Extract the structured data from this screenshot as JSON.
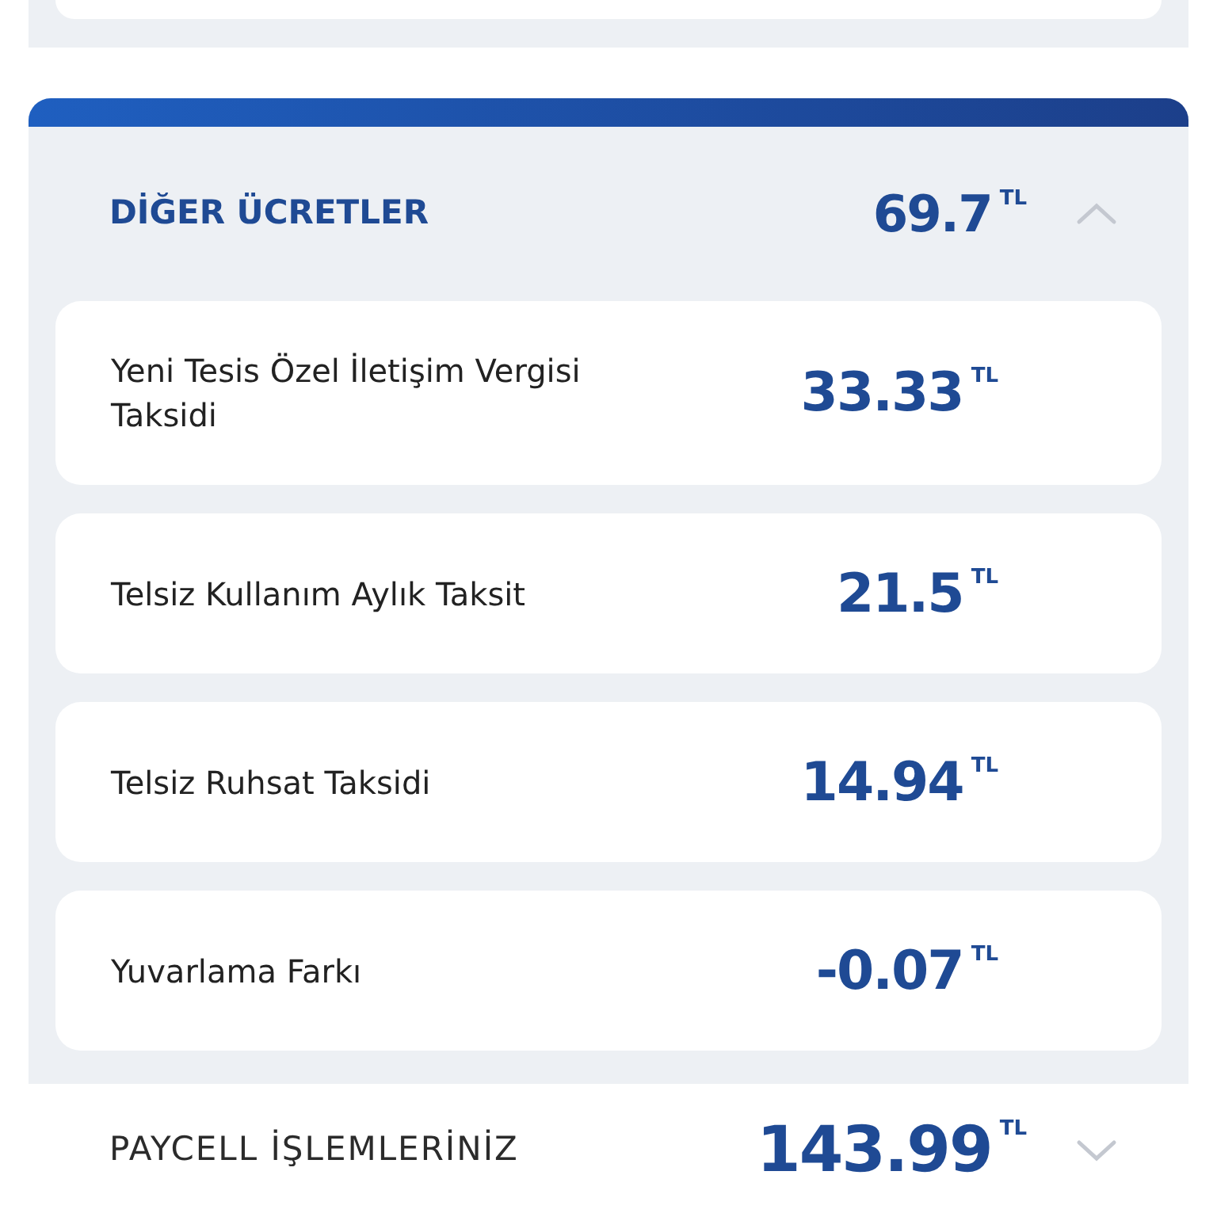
{
  "sections": [
    {
      "kind": "panel",
      "title": "DİĞER ÜCRETLER",
      "amount": "69.7",
      "currency": "TL",
      "expanded": true,
      "items": [
        {
          "label": "Yeni Tesis Özel İletişim Vergisi Taksidi",
          "amount": "33.33",
          "currency": "TL"
        },
        {
          "label": "Telsiz Kullanım Aylık Taksit",
          "amount": "21.5",
          "currency": "TL"
        },
        {
          "label": "Telsiz Ruhsat Taksidi",
          "amount": "14.94",
          "currency": "TL"
        },
        {
          "label": "Yuvarlama Farkı",
          "amount": "-0.07",
          "currency": "TL"
        }
      ]
    },
    {
      "kind": "plain",
      "title": "PAYCELL İŞLEMLERİNİZ",
      "amount": "143.99",
      "currency": "TL",
      "expanded": false
    }
  ]
}
